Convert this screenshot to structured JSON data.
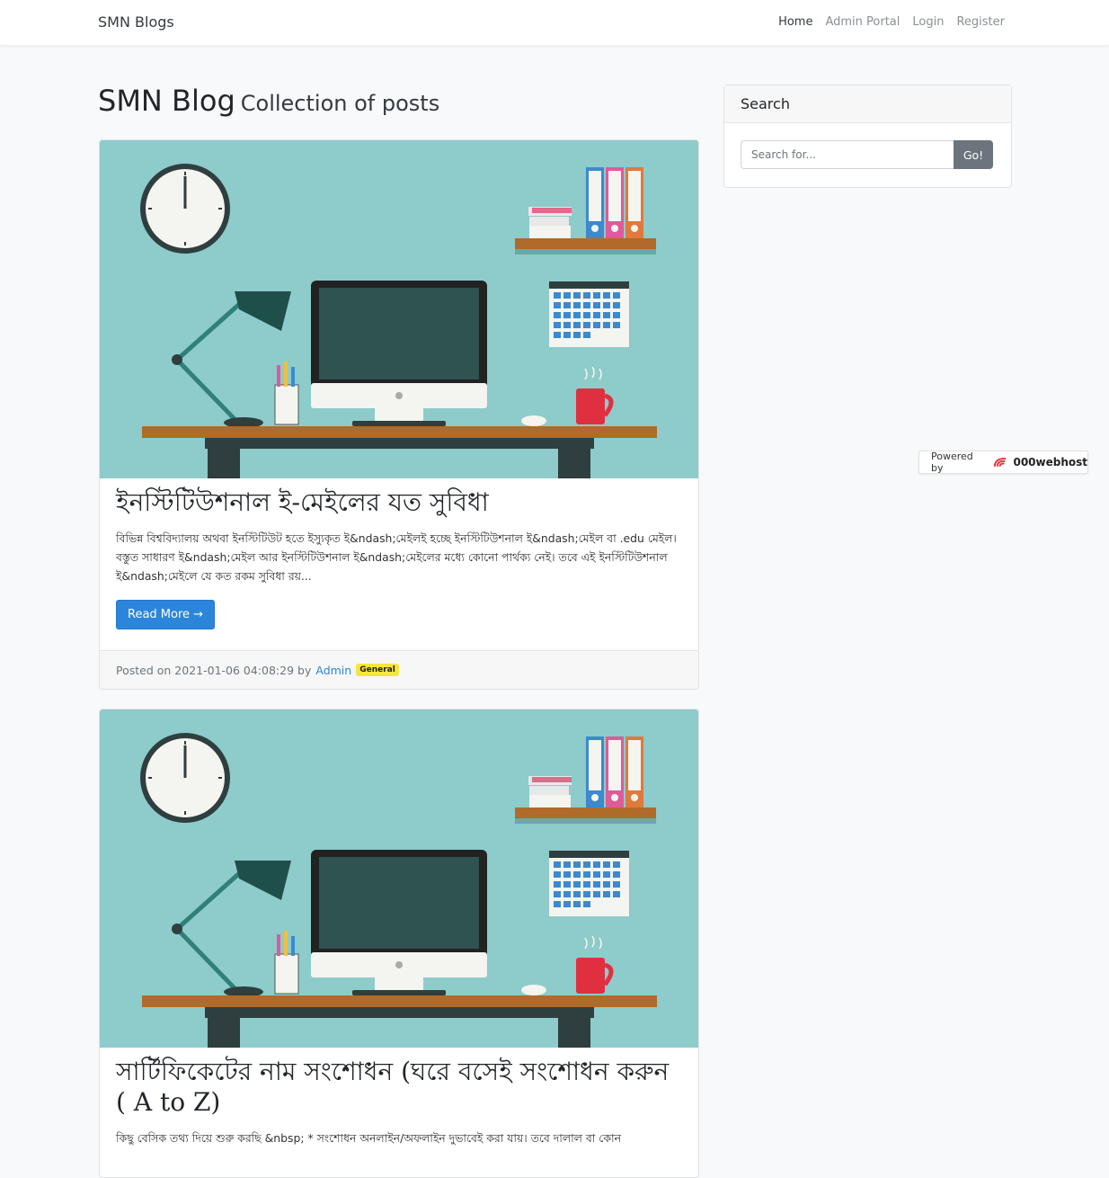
{
  "navbar": {
    "brand": "SMN Blogs",
    "links": [
      "Home",
      "Admin Portal",
      "Login",
      "Register"
    ]
  },
  "heading": {
    "title": "SMN Blog",
    "subtitle": "Collection of posts"
  },
  "posts": [
    {
      "title": "ইনস্টিটিউশনাল ই-মেইলের যত সুবিধা",
      "excerpt": "বিভিন্ন বিশ্ববিদ্যালয় অথবা ইনস্টিটিউট হতে ইস্যুকৃত ই&ndash;মেইলই হচ্ছে ইনস্টিটিউশনাল ই&ndash;মেইল বা .edu মেইল। বস্তুত সাধারণ ই&ndash;মেইল আর ইনস্টিটিউশনাল ই&ndash;মেইলের মধ্যে কোনো পার্থক্য নেই। তবে এই ইনস্টিটিউশনাল ই&ndash;মেইলে যে কত রকম সুবিধা রয়...",
      "read_more": "Read More →",
      "posted_on": "Posted on 2021-01-06 04:08:29 by",
      "author": "Admin",
      "category": "General"
    },
    {
      "title": "সার্টিফিকেটের নাম সংশোধন (ঘরে বসেই সংশোধন করুন ( A to Z)",
      "excerpt": "কিছু বেসিক তথ্য দিয়ে শুরু করছি &nbsp; * সংশোধন অনলাইন/অফলাইন দুভাবেই করা যায়। তবে দালাল বা কোন"
    }
  ],
  "sidebar": {
    "search_title": "Search",
    "search_placeholder": "Search for...",
    "search_button": "Go!"
  },
  "powered_by": {
    "label": "Powered by",
    "brand": "000webhost"
  },
  "colors": {
    "primary": "#2b86db",
    "badge": "#f5e63a",
    "image_bg": "#8ecbcb"
  }
}
